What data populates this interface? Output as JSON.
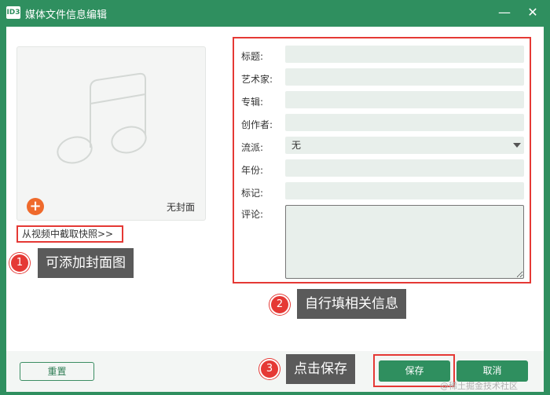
{
  "window": {
    "app_icon_text": "ID3",
    "title": "媒体文件信息编辑",
    "minimize_symbol": "—",
    "close_symbol": "✕"
  },
  "cover": {
    "add_symbol": "+",
    "no_cover_label": "无封面",
    "capture_link": "从视频中截取快照>>"
  },
  "form": {
    "title_label": "标题:",
    "artist_label": "艺术家:",
    "album_label": "专辑:",
    "composer_label": "创作者:",
    "genre_label": "流派:",
    "genre_value": "无",
    "year_label": "年份:",
    "tag_label": "标记:",
    "comment_label": "评论:"
  },
  "callouts": {
    "one": {
      "number": "1",
      "text": "可添加封面图"
    },
    "two": {
      "number": "2",
      "text": "自行填相关信息"
    },
    "three": {
      "number": "3",
      "text": "点击保存"
    }
  },
  "footer": {
    "reset_label": "重置",
    "save_label": "保存",
    "cancel_label": "取消"
  },
  "watermark": "@稀土掘金技术社区",
  "colors": {
    "brand_green": "#2f8f5f",
    "highlight_red": "#e53935",
    "add_orange": "#ef6a2c"
  }
}
